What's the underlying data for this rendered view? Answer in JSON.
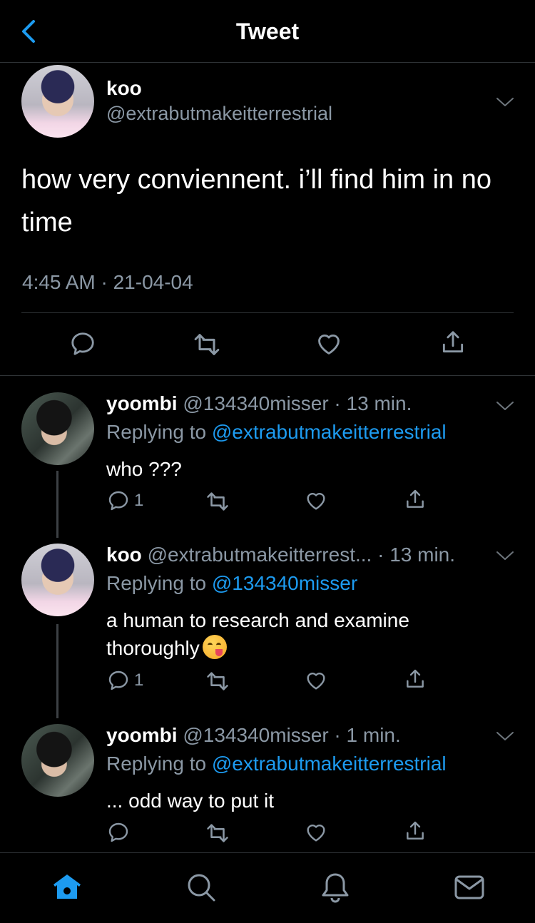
{
  "header": {
    "title": "Tweet"
  },
  "main_tweet": {
    "name": "koo",
    "handle": "@extrabutmakeitterrestrial",
    "text": "how very conviennent. i’ll find him in no time",
    "timestamp": "4:45 AM · 21-04-04"
  },
  "replies": [
    {
      "name": "yoombi",
      "meta": "@134340misser · 13 min.",
      "replying_label": "Replying to",
      "replying_to": "@extrabutmakeitterrestrial",
      "text": "who ???",
      "reply_count": "1"
    },
    {
      "name": "koo",
      "meta": "@extrabutmakeitterrest... · 13 min.",
      "replying_label": "Replying to",
      "replying_to": "@134340misser",
      "text": "a human to research and examine thoroughly",
      "emoji": "yum-emoji",
      "reply_count": "1"
    },
    {
      "name": "yoombi",
      "meta": "@134340misser · 1 min.",
      "replying_label": "Replying to",
      "replying_to": "@extrabutmakeitterrestrial",
      "text": "... odd way to put it",
      "reply_count": ""
    }
  ],
  "icons": {
    "back": "chevron-left-icon",
    "reply": "comment-icon",
    "retweet": "retweet-icon",
    "like": "heart-icon",
    "share": "share-icon",
    "tabs": [
      "home-icon",
      "search-icon",
      "notifications-icon",
      "messages-icon"
    ]
  },
  "colors": {
    "accent": "#1d9bf0",
    "secondary_text": "#8b98a5",
    "background": "#000000"
  }
}
